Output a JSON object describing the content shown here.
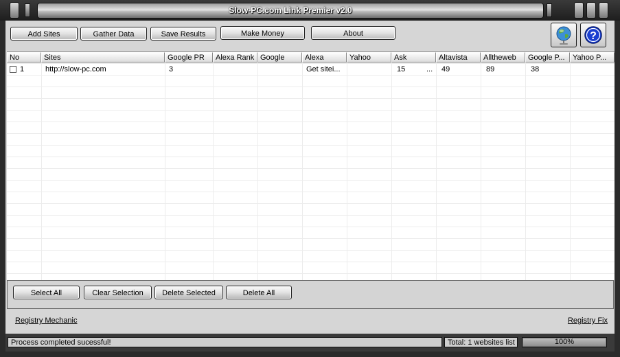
{
  "window": {
    "title": "Slow-PC.com Link Premier v2.0"
  },
  "toolbar": {
    "add_sites": "Add Sites",
    "gather_data": "Gather Data",
    "save_results": "Save Results",
    "make_money": "Make Money",
    "about": "About",
    "icons": [
      "globe-icon",
      "help-icon"
    ]
  },
  "grid": {
    "columns": [
      "No",
      "Sites",
      "Google PR",
      "Alexa Rank",
      "Google",
      "Alexa",
      "Yahoo",
      "Ask",
      "Altavista",
      "Alltheweb",
      "Google P...",
      "Yahoo P..."
    ],
    "rows": [
      {
        "checked": false,
        "no": "1",
        "site": "http://slow-pc.com",
        "google_pr": "3",
        "alexa_rank": "",
        "google": "",
        "alexa": "Get sitei...",
        "yahoo": "",
        "ask": "15",
        "ask_more": "...",
        "altavista": "49",
        "alltheweb": "89",
        "google_p": "38",
        "yahoo_p": ""
      }
    ]
  },
  "actions": {
    "select_all": "Select All",
    "clear_selection": "Clear Selection",
    "delete_selected": "Delete Selected",
    "delete_all": "Delete All"
  },
  "links": {
    "registry_mechanic": "Registry Mechanic",
    "registry_fix": "Registry Fix"
  },
  "status": {
    "message": "Process completed sucessful!",
    "total": "Total: 1 websites list",
    "progress_label": "100%",
    "progress": 1.0
  },
  "colors": {
    "chrome": "#2b2b2b",
    "panel": "#d6d6d6",
    "grid_bg": "#ffffff",
    "help_blue": "#1a3fd0"
  }
}
